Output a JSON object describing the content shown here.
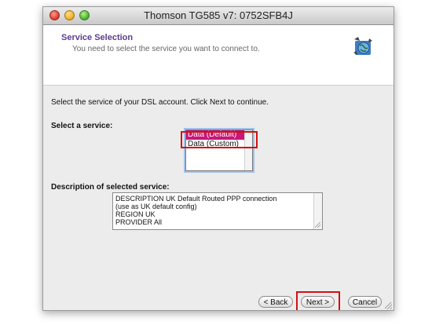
{
  "window": {
    "title": "Thomson TG585 v7:  0752SFB4J"
  },
  "header": {
    "title": "Service Selection",
    "subtitle": "You need to select the service you want to connect to.",
    "icon": "network-globe-icon"
  },
  "content": {
    "intro": "Select the service of your DSL account. Click Next to continue.",
    "select_label": "Select a service:",
    "services": [
      {
        "label": "Data (Default)",
        "selected": true
      },
      {
        "label": "Data (Custom)",
        "selected": false
      }
    ],
    "description_label": "Description of selected service:",
    "description_lines": [
      "DESCRIPTION  UK Default Routed PPP connection",
      "(use as UK default config)",
      "REGION      UK",
      "PROVIDER    All"
    ]
  },
  "buttons": {
    "back": "< Back",
    "next": "Next >",
    "cancel": "Cancel"
  },
  "colors": {
    "header_title": "#5b3d8f",
    "selection": "#c8167a",
    "highlight": "#d21010"
  }
}
